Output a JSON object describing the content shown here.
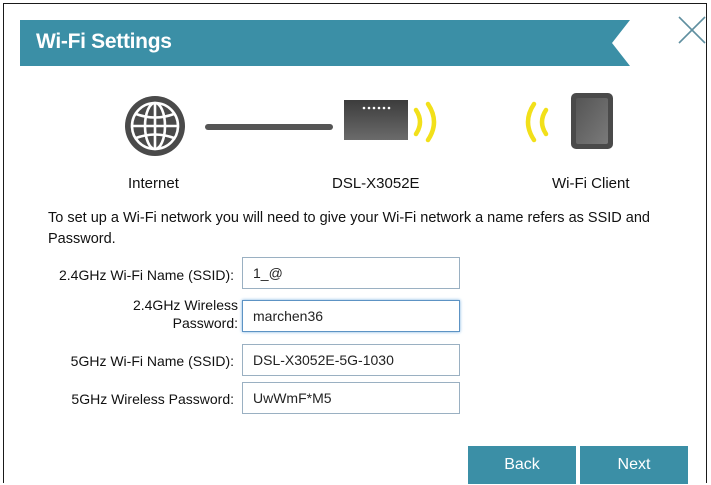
{
  "header": {
    "title": "Wi-Fi Settings",
    "banner_color": "#3b8fa6"
  },
  "diagram": {
    "internet_label": "Internet",
    "router_label": "DSL-X3052E",
    "client_label": "Wi-Fi Client",
    "wave_color": "#f2e01a"
  },
  "intro_text": "To set up a Wi-Fi network you will need to give your Wi-Fi network a name refers as SSID and Password.",
  "fields": {
    "ssid_24": {
      "label": "2.4GHz Wi-Fi Name (SSID):",
      "value": "1_@"
    },
    "pwd_24": {
      "label_line1": "2.4GHz Wireless",
      "label_line2": "Password:",
      "value": "marchen36"
    },
    "ssid_5": {
      "label": "5GHz Wi-Fi Name (SSID):",
      "value": "DSL-X3052E-5G-1030"
    },
    "pwd_5": {
      "label": "5GHz Wireless Password:",
      "value": "UwWmF*M5"
    }
  },
  "buttons": {
    "back": "Back",
    "next": "Next"
  }
}
